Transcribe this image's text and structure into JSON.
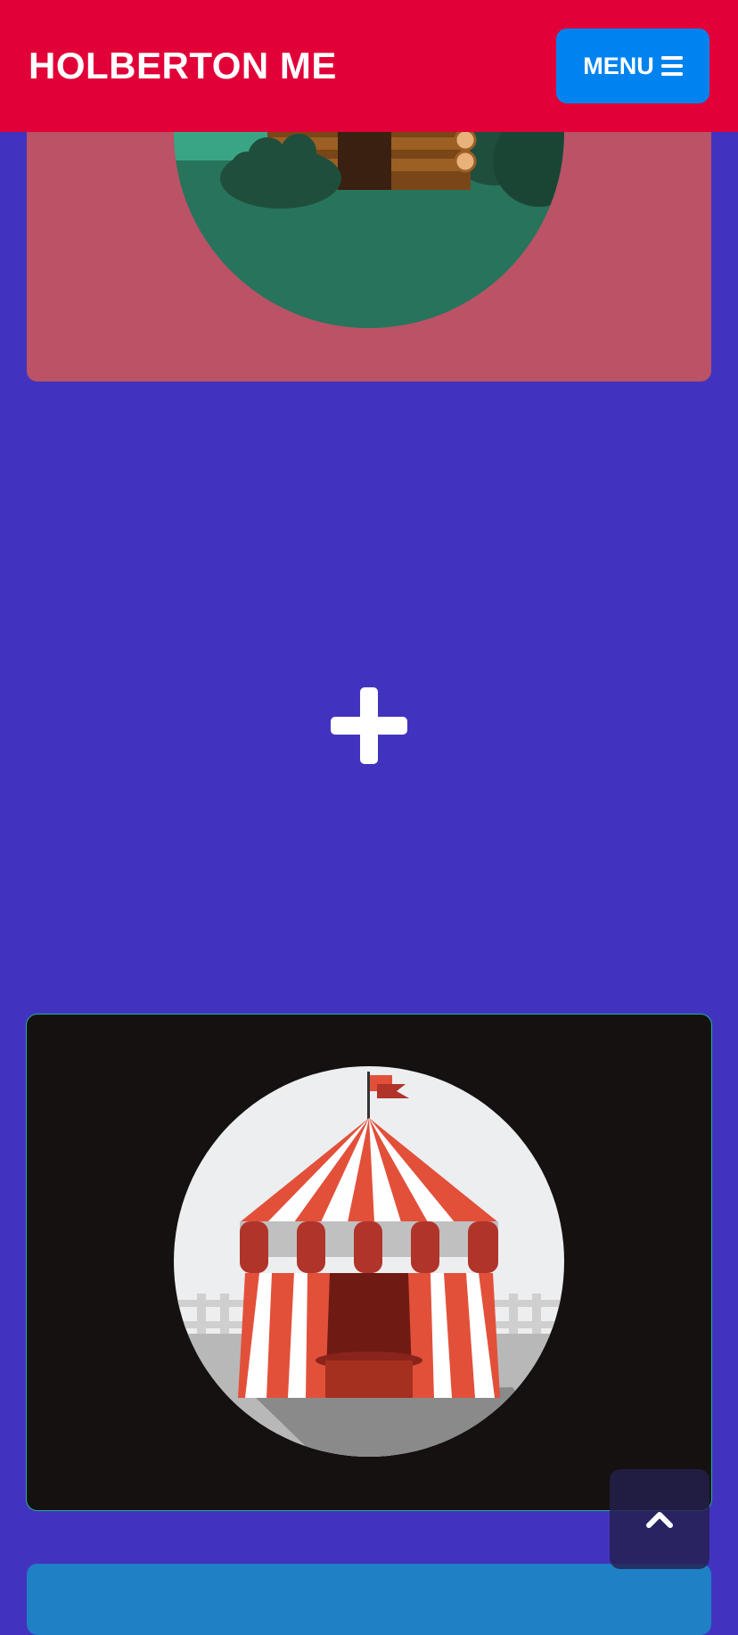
{
  "navbar": {
    "brand": "HOLBERTON ME",
    "menu_label": "MENU",
    "menu_icon": "bars-icon",
    "background": "#e20038",
    "menu_button_color": "#0083ef"
  },
  "page": {
    "background": "#4233be"
  },
  "cards": [
    {
      "illustration": "log-cabin",
      "background": "#bb5266"
    },
    {
      "illustration": "circus-tent",
      "background": "#141110"
    },
    {
      "background": "#1f80c5"
    }
  ],
  "divider_icon": "plus-icon",
  "back_to_top_icon": "chevron-up-icon"
}
